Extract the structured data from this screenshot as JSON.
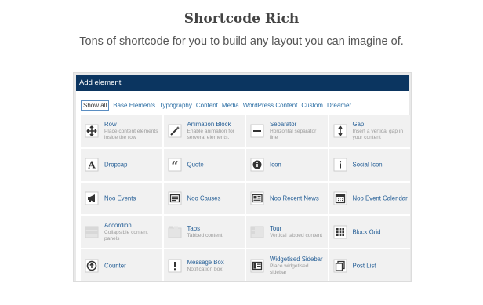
{
  "heading": "Shortcode Rich",
  "subheading": "Tons of shortcode for you to build any layout you can imagine of.",
  "panel": {
    "title": "Add element",
    "tabs": [
      {
        "label": "Show all",
        "active": true
      },
      {
        "label": "Base Elements"
      },
      {
        "label": "Typography"
      },
      {
        "label": "Content"
      },
      {
        "label": "Media"
      },
      {
        "label": "WordPress Content"
      },
      {
        "label": "Custom"
      },
      {
        "label": "Dreamer"
      }
    ],
    "elements": [
      {
        "title": "Row",
        "desc": "Place content elements inside the row",
        "icon": "move-icon"
      },
      {
        "title": "Animation Block",
        "desc": "Enable animation for serveral elements.",
        "icon": "magic-wand-icon"
      },
      {
        "title": "Separator",
        "desc": "Horizontal separator line",
        "icon": "separator-icon"
      },
      {
        "title": "Gap",
        "desc": "Insert a vertical gap in your content",
        "icon": "vertical-arrows-icon"
      },
      {
        "title": "Dropcap",
        "desc": "",
        "icon": "letter-a-icon"
      },
      {
        "title": "Quote",
        "desc": "",
        "icon": "quote-icon"
      },
      {
        "title": "Icon",
        "desc": "",
        "icon": "info-circle-icon"
      },
      {
        "title": "Social Icon",
        "desc": "",
        "icon": "info-icon"
      },
      {
        "title": "Noo Events",
        "desc": "",
        "icon": "megaphone-icon"
      },
      {
        "title": "Noo Causes",
        "desc": "",
        "icon": "causes-icon"
      },
      {
        "title": "Noo Recent News",
        "desc": "",
        "icon": "news-icon"
      },
      {
        "title": "Noo Event Calendar",
        "desc": "",
        "icon": "calendar-icon"
      },
      {
        "title": "Accordion",
        "desc": "Collapsible content panels",
        "icon": "accordion-icon"
      },
      {
        "title": "Tabs",
        "desc": "Tabbed content",
        "icon": "tabs-icon"
      },
      {
        "title": "Tour",
        "desc": "Vertical tabbed content",
        "icon": "tour-icon"
      },
      {
        "title": "Block Grid",
        "desc": "",
        "icon": "grid-icon"
      },
      {
        "title": "Counter",
        "desc": "",
        "icon": "arrow-circle-icon"
      },
      {
        "title": "Message Box",
        "desc": "Notification box",
        "icon": "exclamation-icon"
      },
      {
        "title": "Widgetised Sidebar",
        "desc": "Place widgetised sidebar",
        "icon": "sidebar-icon"
      },
      {
        "title": "Post List",
        "desc": "",
        "icon": "copy-icon"
      }
    ]
  }
}
